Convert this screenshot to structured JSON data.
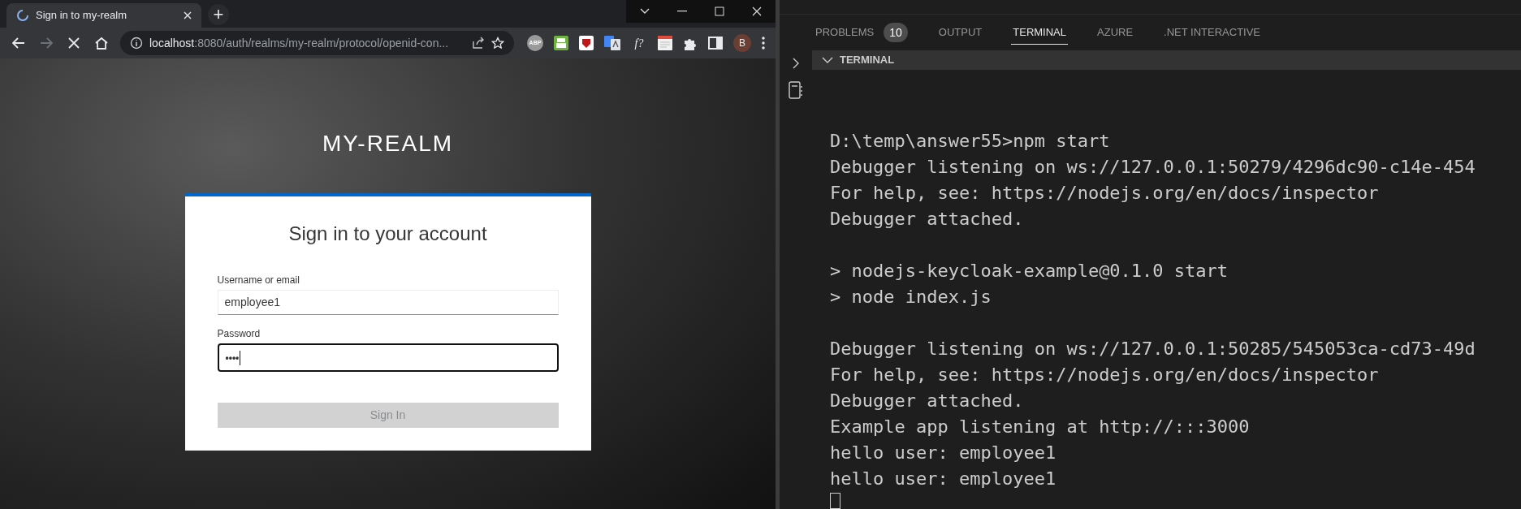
{
  "browser": {
    "tabs": [
      {
        "title": "Sign in to my-realm",
        "selected": true,
        "loading": true
      }
    ],
    "new_tab": "+",
    "address_bar": {
      "host": "localhost",
      "path": ":8080/auth/realms/my-realm/protocol/openid-con..."
    },
    "nav": {
      "forward_disabled": true,
      "loading": true
    },
    "extensions": [
      {
        "kind": "abp",
        "label": "ABP"
      },
      {
        "kind": "printer"
      },
      {
        "kind": "shield"
      },
      {
        "kind": "translate"
      },
      {
        "kind": "formula",
        "label": "f?"
      },
      {
        "kind": "note"
      },
      {
        "kind": "puzzle"
      },
      {
        "kind": "sidebar"
      }
    ],
    "profile": {
      "initial": "B"
    }
  },
  "login_page": {
    "realm": "MY-REALM",
    "card": {
      "title": "Sign in to your account",
      "fields": [
        {
          "label": "Username or email",
          "value": "employee1",
          "kind": "text",
          "focused": false
        },
        {
          "label": "Password",
          "value": "••••",
          "kind": "password",
          "focused": true
        }
      ],
      "submit": {
        "label": "Sign In",
        "disabled": true
      }
    }
  },
  "panel": {
    "tabs": [
      {
        "label": "PROBLEMS",
        "badge": "10",
        "selected": false
      },
      {
        "label": "OUTPUT",
        "selected": false
      },
      {
        "label": "TERMINAL",
        "selected": true
      },
      {
        "label": "AZURE",
        "selected": false
      },
      {
        "label": ".NET INTERACTIVE",
        "selected": false
      }
    ],
    "section": {
      "title": "TERMINAL",
      "expanded": true
    },
    "terminal_blocks": [
      [
        "D:\\temp\\answer55>npm start",
        "Debugger listening on ws://127.0.0.1:50279/4296dc90-c14e-454",
        "For help, see: https://nodejs.org/en/docs/inspector",
        "Debugger attached."
      ],
      [
        "> nodejs-keycloak-example@0.1.0 start",
        "> node index.js"
      ],
      [
        "Debugger listening on ws://127.0.0.1:50285/545053ca-cd73-49d",
        "For help, see: https://nodejs.org/en/docs/inspector",
        "Debugger attached.",
        "Example app listening at http://:::3000",
        "hello user: employee1",
        "hello user: employee1"
      ]
    ],
    "cursor": true
  }
}
